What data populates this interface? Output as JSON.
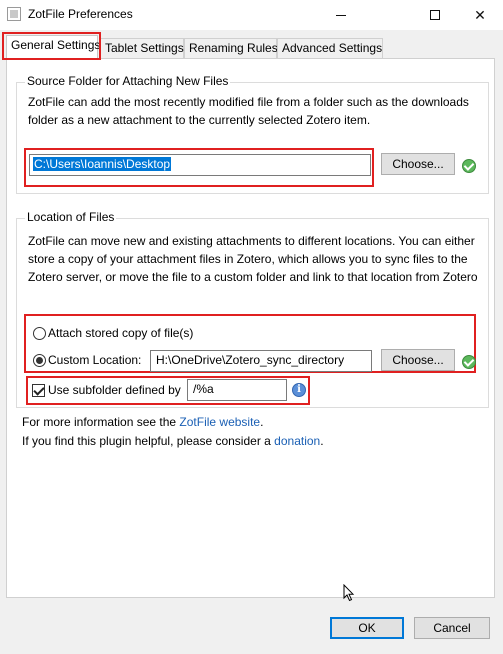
{
  "window": {
    "title": "ZotFile Preferences",
    "minimize_glyph": "",
    "close_glyph": "✕"
  },
  "tabs": [
    {
      "label": "General Settings",
      "active": true
    },
    {
      "label": "Tablet Settings",
      "active": false
    },
    {
      "label": "Renaming Rules",
      "active": false
    },
    {
      "label": "Advanced Settings",
      "active": false
    }
  ],
  "source_folder": {
    "legend": "Source Folder for Attaching New Files",
    "description": "ZotFile can add the most recently modified file from a folder such as the downloads folder as a new attachment to the currently selected Zotero item.",
    "path_value": "C:\\Users\\Ioannis\\Desktop",
    "choose_label": "Choose..."
  },
  "location": {
    "legend": "Location of Files",
    "description": "ZotFile can move new and existing attachments to different locations. You can either store a copy of your attachment files in Zotero, which allows you to sync files to the Zotero server, or move the file to a custom folder and link to that location from Zotero",
    "radio_stored_label": "Attach stored copy of file(s)",
    "radio_custom_label": "Custom Location:",
    "selected_option": "custom",
    "custom_path_value": "H:\\OneDrive\\Zotero_sync_directory",
    "choose_label": "Choose...",
    "subfolder_label": "Use subfolder defined by",
    "subfolder_checked": true,
    "subfolder_value": "/%a"
  },
  "footer_info": {
    "website_prefix": "For more information see the ",
    "website_link": "ZotFile website",
    "website_suffix": ".",
    "donation_prefix": "If you find this plugin helpful, please consider a ",
    "donation_link": "donation",
    "donation_suffix": "."
  },
  "buttons": {
    "ok_label": "OK",
    "cancel_label": "Cancel"
  },
  "colors": {
    "highlight": "#e02020",
    "link": "#1a5fb4",
    "selection": "#0078d7",
    "ok_green": "#5cb85c"
  }
}
